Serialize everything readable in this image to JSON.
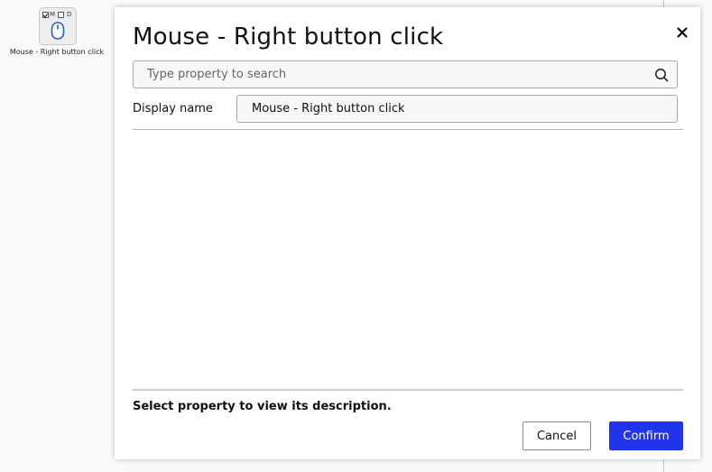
{
  "background": {
    "node": {
      "icon": "mouse-icon",
      "flag_m": "M",
      "flag_d": "D",
      "flag_m_checked": true,
      "flag_d_checked": false,
      "label": "Mouse - Right button click"
    }
  },
  "dialog": {
    "title": "Mouse - Right button click",
    "close_icon": "close-icon",
    "search": {
      "placeholder": "Type property to search",
      "value": "",
      "icon": "search-icon"
    },
    "properties": [
      {
        "label": "Display name",
        "value": "Mouse - Right button click"
      }
    ],
    "description": "Select property to view its description.",
    "buttons": {
      "cancel": "Cancel",
      "confirm": "Confirm"
    }
  },
  "colors": {
    "accent": "#2233ee",
    "mouse_icon": "#1f5fd6"
  }
}
